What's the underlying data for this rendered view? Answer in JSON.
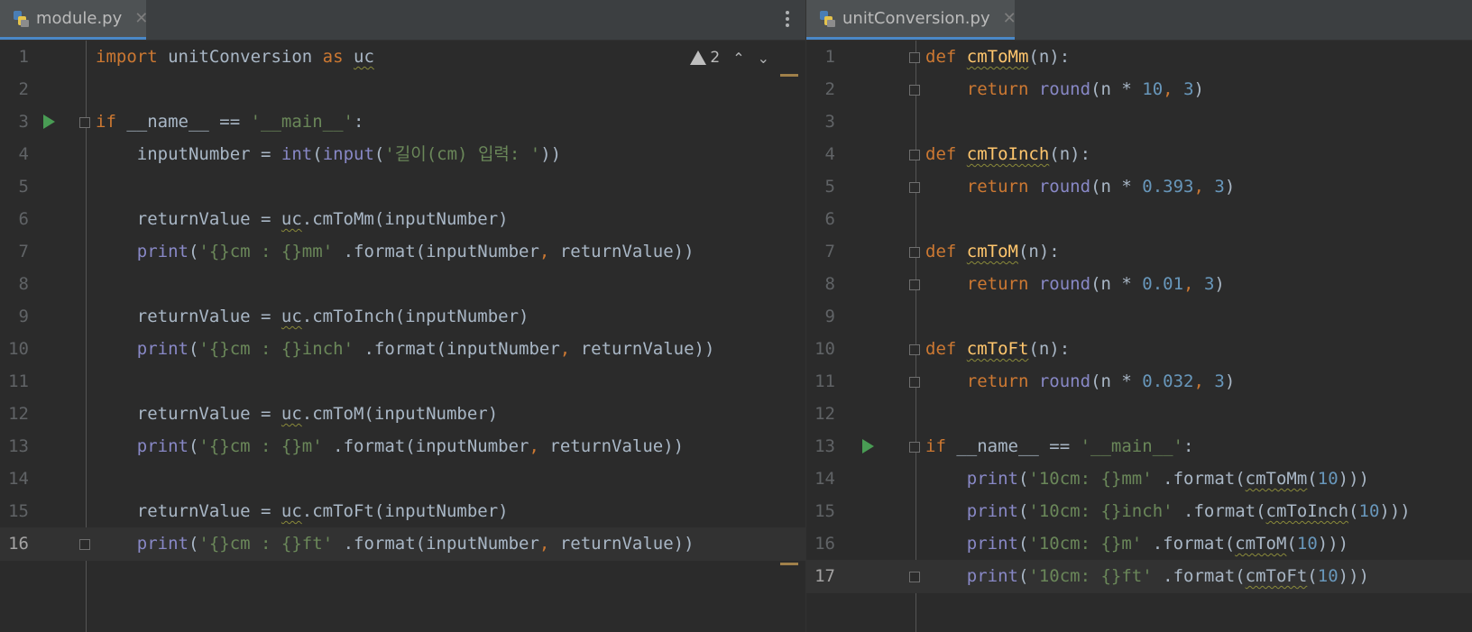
{
  "left_pane": {
    "tab": {
      "icon": "python-file-icon",
      "name": "module.py",
      "close": "✕"
    },
    "menu_icon": "more-vertical-icon",
    "inspection": {
      "icon": "warning-icon",
      "count": "2",
      "prev_icon": "chevron-up-icon",
      "next_icon": "chevron-down-icon"
    },
    "lines": [
      {
        "n": "1",
        "text": "import unitConversion as uc"
      },
      {
        "n": "2",
        "text": ""
      },
      {
        "n": "3",
        "text": "if __name__ == '__main__':"
      },
      {
        "n": "4",
        "text": "    inputNumber = int(input('길이(cm) 입력: '))"
      },
      {
        "n": "5",
        "text": ""
      },
      {
        "n": "6",
        "text": "    returnValue = uc.cmToMm(inputNumber)"
      },
      {
        "n": "7",
        "text": "    print('{}cm : {}mm' .format(inputNumber, returnValue))"
      },
      {
        "n": "8",
        "text": ""
      },
      {
        "n": "9",
        "text": "    returnValue = uc.cmToInch(inputNumber)"
      },
      {
        "n": "10",
        "text": "    print('{}cm : {}inch' .format(inputNumber, returnValue))"
      },
      {
        "n": "11",
        "text": ""
      },
      {
        "n": "12",
        "text": "    returnValue = uc.cmToM(inputNumber)"
      },
      {
        "n": "13",
        "text": "    print('{}cm : {}m' .format(inputNumber, returnValue))"
      },
      {
        "n": "14",
        "text": ""
      },
      {
        "n": "15",
        "text": "    returnValue = uc.cmToFt(inputNumber)"
      },
      {
        "n": "16",
        "text": "    print('{}cm : {}ft' .format(inputNumber, returnValue))"
      }
    ],
    "current_line": "16",
    "run_line": "3"
  },
  "right_pane": {
    "tab": {
      "icon": "python-file-icon",
      "name": "unitConversion.py",
      "close": "✕"
    },
    "lines": [
      {
        "n": "1",
        "text": "def cmToMm(n):"
      },
      {
        "n": "2",
        "text": "    return round(n * 10, 3)"
      },
      {
        "n": "3",
        "text": ""
      },
      {
        "n": "4",
        "text": "def cmToInch(n):"
      },
      {
        "n": "5",
        "text": "    return round(n * 0.393, 3)"
      },
      {
        "n": "6",
        "text": ""
      },
      {
        "n": "7",
        "text": "def cmToM(n):"
      },
      {
        "n": "8",
        "text": "    return round(n * 0.01, 3)"
      },
      {
        "n": "9",
        "text": ""
      },
      {
        "n": "10",
        "text": "def cmToFt(n):"
      },
      {
        "n": "11",
        "text": "    return round(n * 0.032, 3)"
      },
      {
        "n": "12",
        "text": ""
      },
      {
        "n": "13",
        "text": "if __name__ == '__main__':"
      },
      {
        "n": "14",
        "text": "    print('10cm: {}mm' .format(cmToMm(10)))"
      },
      {
        "n": "15",
        "text": "    print('10cm: {}inch' .format(cmToInch(10)))"
      },
      {
        "n": "16",
        "text": "    print('10cm: {}m' .format(cmToM(10)))"
      },
      {
        "n": "17",
        "text": "    print('10cm: {}ft' .format(cmToFt(10)))"
      }
    ],
    "current_line": "17",
    "run_line": "13"
  },
  "colors": {
    "background": "#2b2b2b",
    "keyword": "#cc7832",
    "string": "#6a8759",
    "number": "#6897bb",
    "builtin": "#8888c6",
    "function_def": "#ffc66d",
    "default_text": "#a9b7c6",
    "run_marker": "#499c54"
  }
}
